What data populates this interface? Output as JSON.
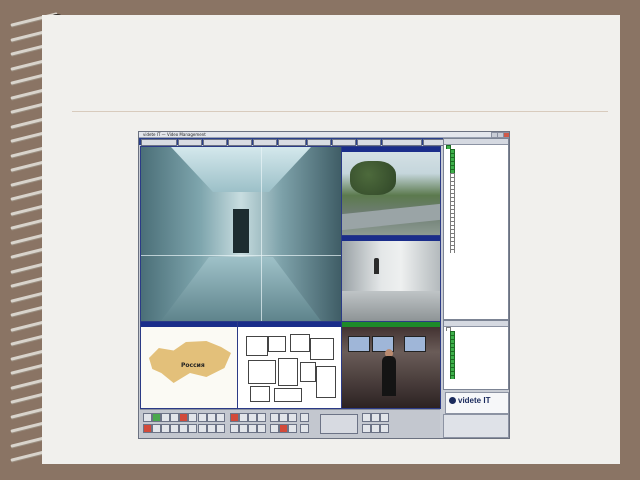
{
  "window": {
    "title": "videte IT — Video Management"
  },
  "menu": {
    "items": [
      "",
      "",
      "",
      "",
      "",
      "",
      "",
      "",
      "",
      "",
      ""
    ]
  },
  "cameras": [
    {
      "id": "corridor",
      "header": ""
    },
    {
      "id": "outdoor",
      "header": "",
      "header_color": "blue"
    },
    {
      "id": "hallway",
      "header": "",
      "header_color": "blue"
    },
    {
      "id": "map-russia",
      "header": ""
    },
    {
      "id": "floorplan",
      "header": ""
    },
    {
      "id": "office",
      "header": "",
      "header_color": "green"
    }
  ],
  "map": {
    "label": "Россия"
  },
  "tree_panel": {
    "items": [
      "",
      "",
      "",
      "",
      "",
      "",
      "",
      "",
      "",
      "",
      "",
      "",
      "",
      "",
      "",
      "",
      "",
      "",
      "",
      "",
      "",
      "",
      "",
      "",
      "",
      "",
      ""
    ],
    "checked": [
      true,
      true,
      true,
      true,
      true,
      true,
      true,
      false,
      false,
      false,
      false,
      false,
      false,
      false,
      false,
      false,
      false,
      false,
      false,
      false,
      false,
      false,
      false,
      false,
      false,
      false,
      false
    ]
  },
  "tree_panel2": {
    "items": [
      "",
      "",
      "",
      "",
      "",
      "",
      "",
      "",
      "",
      "",
      "",
      "",
      ""
    ],
    "checked": [
      false,
      true,
      true,
      true,
      true,
      true,
      true,
      true,
      true,
      true,
      true,
      true,
      true
    ]
  },
  "brand": {
    "name": "videte IT",
    "tagline": "",
    "color": "#1a2a5c"
  },
  "colors": {
    "panel_header_blue": "#1a2d8a",
    "panel_header_green": "#1e8a2a",
    "check_green": "#3db04a",
    "background_frame": "#8a7464",
    "paper": "#f1f0ed"
  }
}
